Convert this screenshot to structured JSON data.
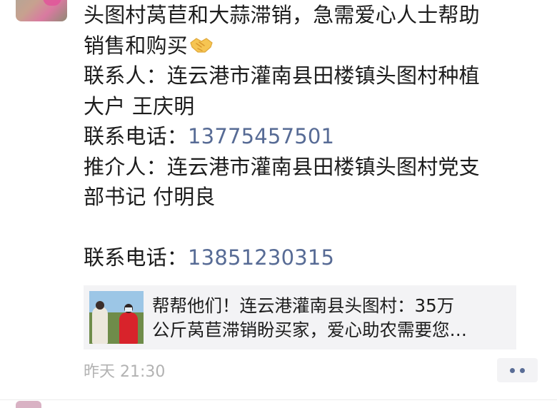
{
  "post": {
    "line1": "头图村莴苣和大蒜滞销，急需爱心人士帮助",
    "line2": "销售和购买",
    "line2_emoji": "handshake",
    "line3": "联系人：连云港市灌南县田楼镇头图村种植",
    "line4": "大户 王庆明",
    "contact_phone_label": "联系电话：",
    "contact_phone": "13775457501",
    "line6": "推介人：连云港市灌南县田楼镇头图村党支",
    "line7": "部书记 付明良",
    "referrer_phone_label": "联系电话：",
    "referrer_phone": "13851230315"
  },
  "link_card": {
    "title_line1": "帮帮他们！连云港灌南县头图村：35万",
    "title_line2": "公斤莴苣滞销盼买家，爱心助农需要您…"
  },
  "footer": {
    "timestamp": "昨天 21:30",
    "more_icon": "more-dots-icon"
  },
  "colors": {
    "text": "#1c1c1c",
    "link": "#576b95",
    "meta": "#b2b2b2",
    "card_bg": "#f3f3f5"
  }
}
